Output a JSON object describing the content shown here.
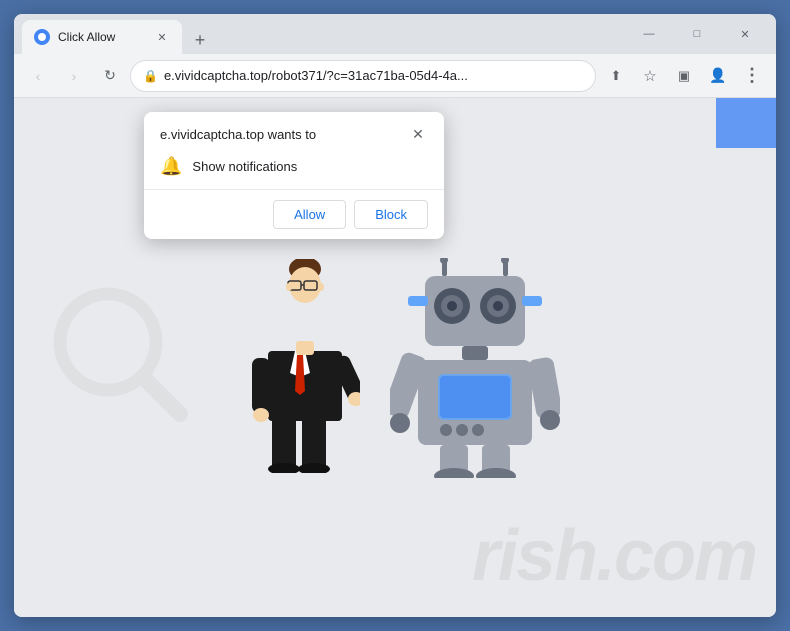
{
  "browser": {
    "tab": {
      "title": "Click Allow",
      "favicon": "globe"
    },
    "window_controls": {
      "minimize": "—",
      "maximize": "□",
      "close": "✕"
    },
    "toolbar": {
      "back": "‹",
      "forward": "›",
      "reload": "↻",
      "url": "e.vividcaptcha.top/robot371/?c=31ac71ba-05d4-4a...",
      "lock_icon": "🔒"
    }
  },
  "popup": {
    "domain": "e.vividcaptcha.top wants to",
    "close_icon": "✕",
    "notification_label": "Show notifications",
    "allow_button": "Allow",
    "block_button": "Block"
  },
  "watermark": {
    "text": "rish.com"
  },
  "icons": {
    "bell": "🔔",
    "share": "⬆",
    "bookmark": "☆",
    "extension": "▣",
    "account": "👤",
    "menu": "⋮",
    "new_tab": "+"
  }
}
